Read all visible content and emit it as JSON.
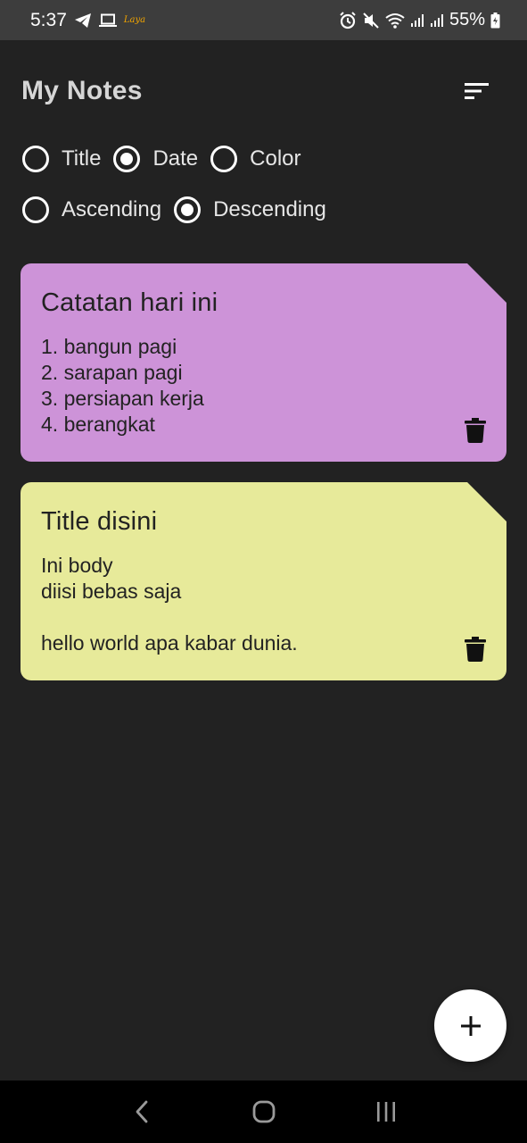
{
  "status_bar": {
    "time": "5:37",
    "app_badge": "Laya",
    "battery": "55%"
  },
  "header": {
    "title": "My Notes"
  },
  "sort_options": {
    "sort_by": [
      {
        "label": "Title",
        "selected": false
      },
      {
        "label": "Date",
        "selected": true
      },
      {
        "label": "Color",
        "selected": false
      }
    ],
    "order": [
      {
        "label": "Ascending",
        "selected": false
      },
      {
        "label": "Descending",
        "selected": true
      }
    ]
  },
  "notes": [
    {
      "title": "Catatan hari ini",
      "body": "1. bangun pagi\n2. sarapan pagi\n3. persiapan kerja\n4. berangkat",
      "color": "#cd93d8"
    },
    {
      "title": "Title disini",
      "body": "Ini body\ndiisi bebas saja\n\nhello world apa kabar dunia.",
      "color": "#e7ea9a"
    }
  ],
  "icons": {
    "sort": "sort-icon",
    "delete": "trash-icon",
    "add": "plus-icon",
    "back": "back-icon",
    "home": "home-icon",
    "recents": "recents-icon"
  },
  "colors": {
    "background": "#222222",
    "status_bar": "#3d3d3d",
    "nav_bar": "#000000",
    "fab": "#ffffff"
  }
}
